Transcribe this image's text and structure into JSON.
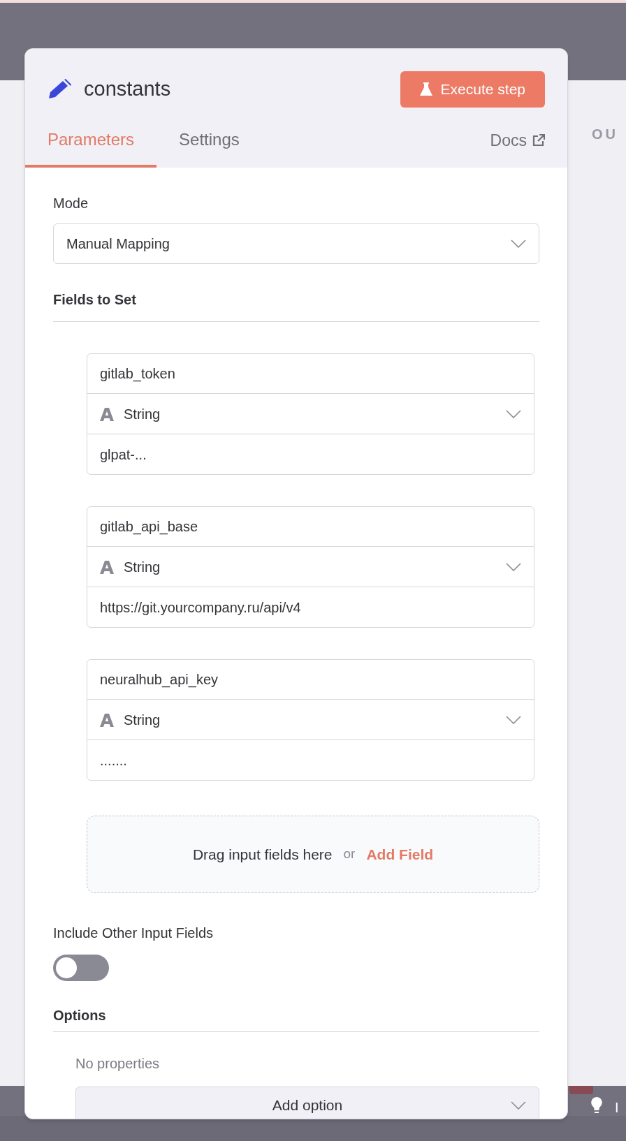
{
  "node": {
    "title": "constants",
    "execute_button": "Execute step"
  },
  "tabs": [
    {
      "label": "Parameters",
      "selected": true
    },
    {
      "label": "Settings",
      "selected": false
    }
  ],
  "docs_link": "Docs",
  "mode": {
    "label": "Mode",
    "value": "Manual Mapping"
  },
  "fields_section": "Fields to Set",
  "fields": [
    {
      "name": "gitlab_token",
      "type": "String",
      "value": "glpat-..."
    },
    {
      "name": "gitlab_api_base",
      "type": "String",
      "value": "https://git.yourcompany.ru/api/v4"
    },
    {
      "name": "neuralhub_api_key",
      "type": "String",
      "value": "......."
    }
  ],
  "dropzone": {
    "text": "Drag input fields here",
    "separator": "or",
    "link": "Add Field"
  },
  "include_other": {
    "label": "Include Other Input Fields",
    "on": false
  },
  "options": {
    "title": "Options",
    "empty_text": "No properties",
    "add_button": "Add option"
  },
  "background": {
    "output_heading": "OU",
    "footer_text": "I"
  }
}
